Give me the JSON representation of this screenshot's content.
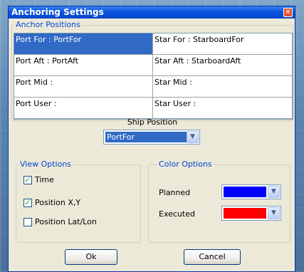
{
  "window": {
    "title": "Anchoring Settings",
    "close_icon": "close-icon"
  },
  "anchor_positions": {
    "legend": "Anchor Positions",
    "rows": [
      {
        "port": "Port For : PortFor",
        "star": "Star For : StarboardFor",
        "selected": true
      },
      {
        "port": "Port Aft : PortAft",
        "star": "Star Aft : StarboardAft",
        "selected": false
      },
      {
        "port": "Port Mid :",
        "star": "Star Mid :",
        "selected": false
      },
      {
        "port": "Port User :",
        "star": "Star User :",
        "selected": false
      }
    ]
  },
  "ship_position": {
    "label": "Ship Position",
    "value": "PortFor"
  },
  "view_options": {
    "legend": "View Options",
    "items": [
      {
        "label": "Time",
        "checked": true
      },
      {
        "label": "Position X,Y",
        "checked": true
      },
      {
        "label": "Position Lat/Lon",
        "checked": false
      }
    ]
  },
  "color_options": {
    "legend": "Color Options",
    "planned_label": "Planned",
    "planned_color": "#0000ff",
    "executed_label": "Executed",
    "executed_color": "#ff0000"
  },
  "buttons": {
    "ok": "Ok",
    "cancel": "Cancel"
  }
}
